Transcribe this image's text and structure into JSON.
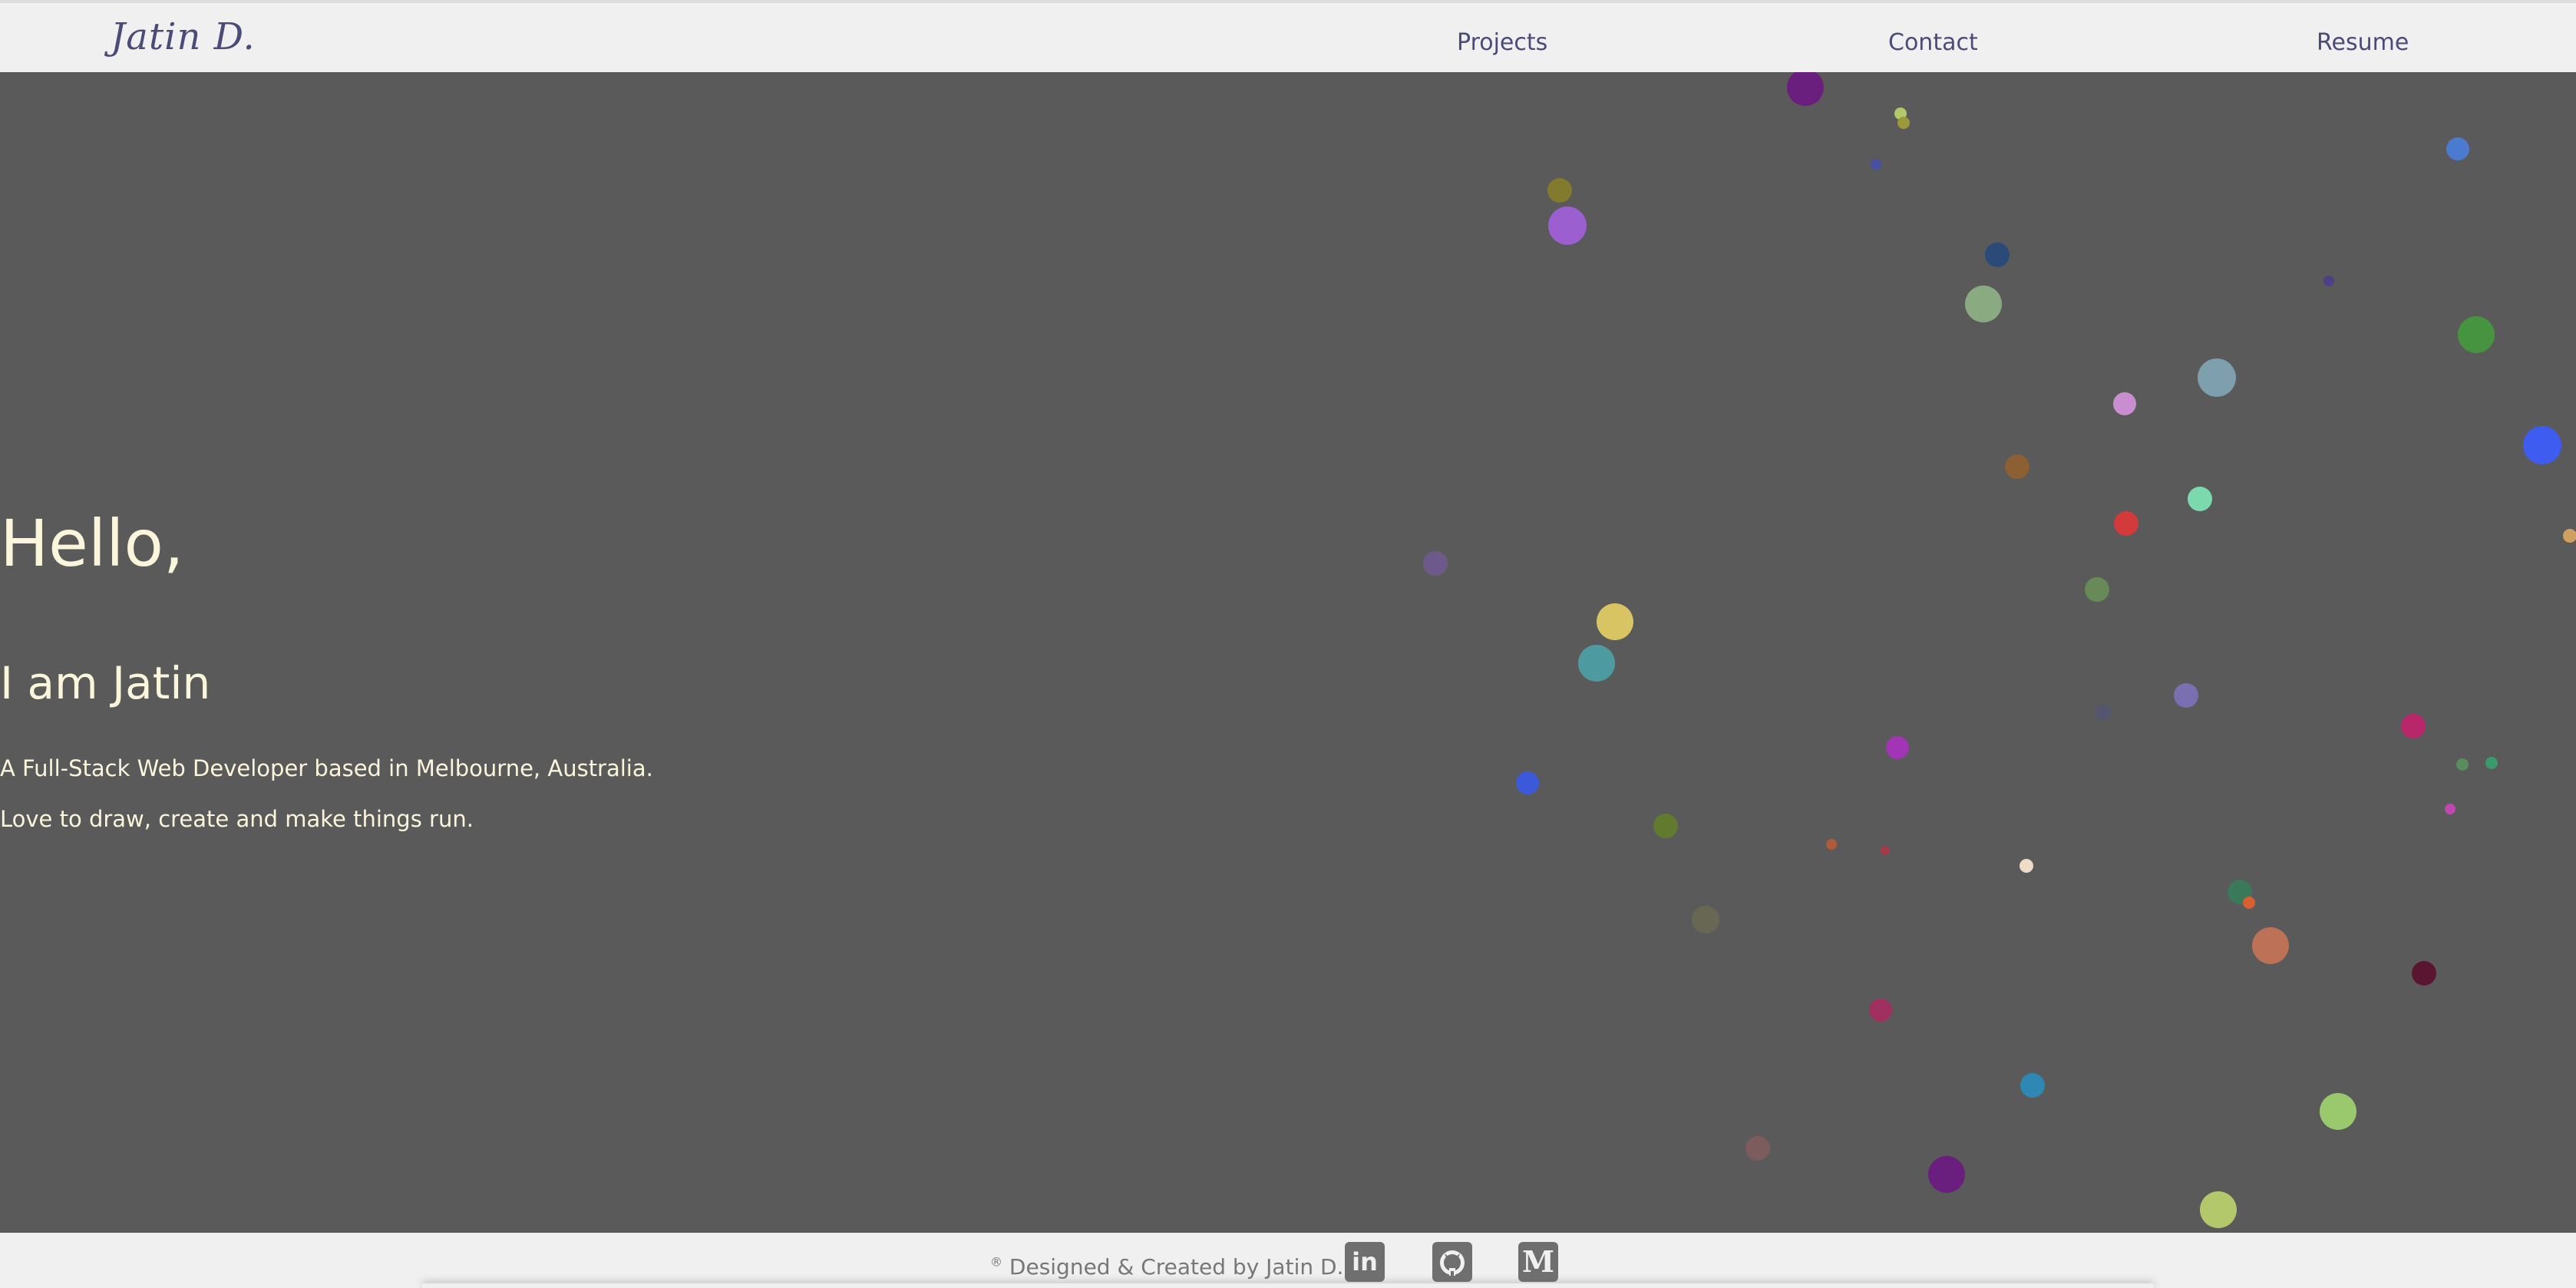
{
  "header": {
    "logo": "Jatin D.",
    "nav": [
      {
        "label": "Projects"
      },
      {
        "label": "Contact"
      },
      {
        "label": "Resume"
      }
    ]
  },
  "hero": {
    "greeting": "Hello,",
    "name_line": "I am Jatin",
    "description_1": "A Full-Stack Web Developer based in Melbourne, Australia.",
    "description_2": "Love to draw, create and make things run."
  },
  "footer": {
    "copyright_symbol": "®",
    "copyright": "Designed & Created by Jatin D.",
    "social": [
      {
        "name": "linkedin",
        "glyph": "in"
      },
      {
        "name": "github",
        "glyph": "github"
      },
      {
        "name": "medium",
        "glyph": "M"
      }
    ]
  },
  "colors": {
    "background": "#5a5a5a",
    "bar": "#f0f0f0",
    "accent": "#4b4b7a",
    "hero_text": "#fbf5dc",
    "dots": [
      "#6a1f7e",
      "#b3c86a",
      "#9a9a3a",
      "#4950a3",
      "#827a2d",
      "#9b5fd0",
      "#2c4a78",
      "#8aab82",
      "#4a7bd0",
      "#4e3f86",
      "#479440",
      "#7d9fae",
      "#c98ecf",
      "#8c6033",
      "#3e5df0",
      "#d33a3a",
      "#7cd9ae",
      "#678a58",
      "#cfa060",
      "#6e5a8a",
      "#7a6fb0",
      "#d8c462",
      "#4d9ba0",
      "#a235b6",
      "#b7276a",
      "#3b59d8",
      "#627a2d",
      "#b05a3a",
      "#a43a4a",
      "#efdcc8",
      "#5b8c5d",
      "#c046b2",
      "#3a9a6a",
      "#3a7a5a",
      "#d75f30",
      "#bd7257",
      "#5a1630",
      "#a03060",
      "#2f88b4",
      "#9ac86d",
      "#7c5c5c"
    ]
  }
}
